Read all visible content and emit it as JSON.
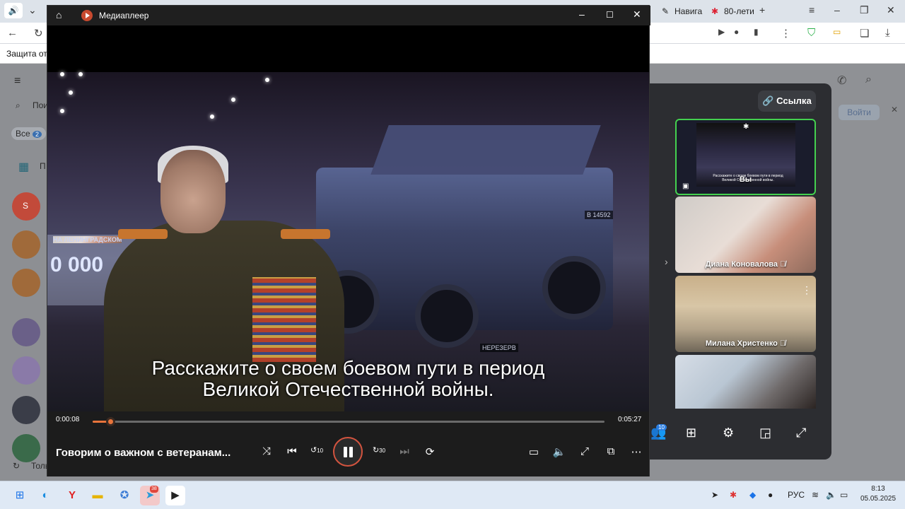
{
  "browser": {
    "tab1": "Навига",
    "tab2": "80-лети",
    "info_text": "Защита от в"
  },
  "messenger": {
    "tab_all": "Все",
    "tab_all_count": "2",
    "search_stub": "Пои",
    "item_stub": "П",
    "avatar_letter": "S",
    "bottom_stub": "Толь",
    "join_label": "Войти"
  },
  "call": {
    "link_label": "Ссылка",
    "tiles": [
      {
        "name": "Вы",
        "caption": "Расскажите о своем боевом пути в период Великой Отечественной войны."
      },
      {
        "name": "Диана Коновалова"
      },
      {
        "name": "Милана Христенко"
      },
      {
        "name": ""
      }
    ],
    "participants_count": "10"
  },
  "player": {
    "app_title": "Медиаплеер",
    "subtitle_line1": "Расскажите о своем боевом пути в период",
    "subtitle_line2": "Великой Отечественной войны.",
    "banner_text": "0 000",
    "banner_top": "НА ЛЕНИНГРАДСКОМ",
    "plate1": "В 14592",
    "plate2": "НЕРЕЗЕРВ",
    "current_time": "0:00:08",
    "total_time": "0:05:27",
    "progress_fraction": 0.035,
    "media_title": "Говорим о важном с ветеранам...",
    "skip_back_seconds": "10",
    "skip_forward_seconds": "30",
    "accent_color": "#e8743b"
  },
  "taskbar": {
    "telegram_badge": "38",
    "language": "РУС",
    "time": "8:13",
    "date": "05.05.2025"
  }
}
